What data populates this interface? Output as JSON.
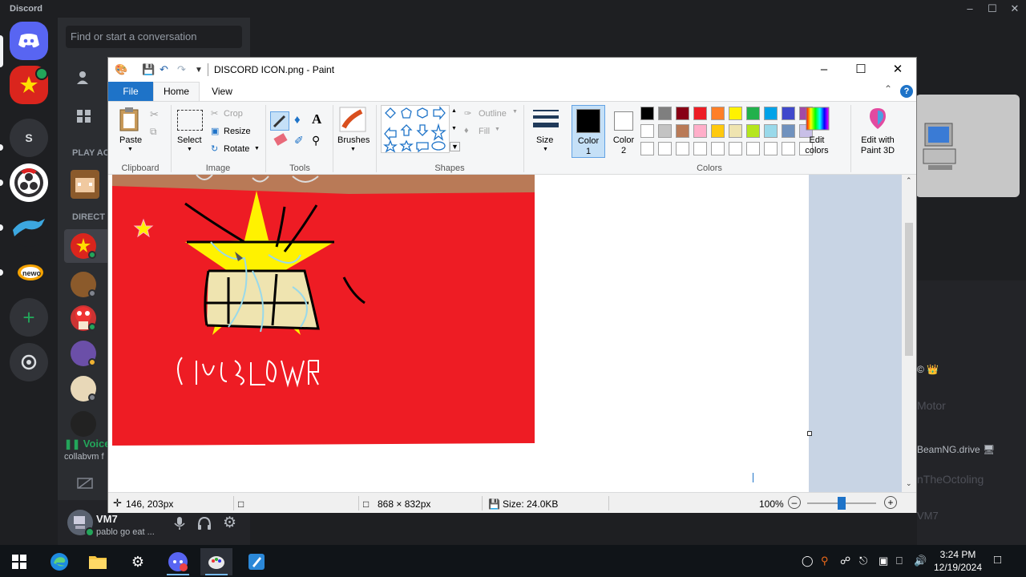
{
  "discord": {
    "brand": "Discord",
    "search_placeholder": "Find or start a conversation",
    "labels": {
      "play": "PLAY AC",
      "direct": "DIRECT"
    },
    "voice": {
      "status": "Voice",
      "channel": "collabvm f"
    },
    "user": {
      "name": "VM7",
      "status": "pablo go eat ..."
    },
    "server_initial": "S",
    "right_texts": [
      "© 👑",
      "Motor",
      "BeamNG.drive 🖥",
      "nTheOctoling",
      "VM7"
    ]
  },
  "paint": {
    "title": "DISCORD ICON.png - Paint",
    "tabs": {
      "file": "File",
      "home": "Home",
      "view": "View"
    },
    "groups": {
      "clipboard": "Clipboard",
      "image": "Image",
      "tools": "Tools",
      "shapes": "Shapes",
      "colors": "Colors"
    },
    "buttons": {
      "paste": "Paste",
      "select": "Select",
      "crop": "Crop",
      "resize": "Resize",
      "rotate": "Rotate",
      "brushes": "Brushes",
      "outline": "Outline",
      "fill": "Fill",
      "size": "Size",
      "color1": "Color\n1",
      "color2": "Color\n2",
      "edit_colors": "Edit\ncolors",
      "edit_paint3d": "Edit with\nPaint 3D"
    },
    "palette_row1": [
      "#000000",
      "#7f7f7f",
      "#880015",
      "#ed1c24",
      "#ff7f27",
      "#fff200",
      "#22b14c",
      "#00a2e8",
      "#3f48cc",
      "#a349a4"
    ],
    "palette_row2": [
      "#ffffff",
      "#c3c3c3",
      "#b97a57",
      "#ffaec9",
      "#ffc90e",
      "#efe4b0",
      "#b5e61d",
      "#99d9ea",
      "#7092be",
      "#c8bfe7"
    ],
    "canvas_text": "CruB Lowe",
    "status": {
      "position": "146, 203px",
      "dimensions": "868 × 832px",
      "size": "Size: 24.0KB",
      "zoom": "100%",
      "zoom_level": 0.5
    }
  },
  "taskbar": {
    "time": "3:24 PM",
    "date": "12/19/2024"
  }
}
